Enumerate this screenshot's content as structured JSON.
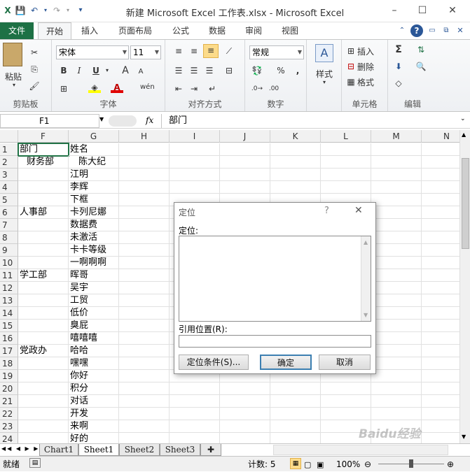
{
  "window": {
    "title": "新建 Microsoft Excel 工作表.xlsx - Microsoft Excel",
    "minimize": "–",
    "maximize": "☐",
    "close": "✕"
  },
  "ribbon_tabs": [
    "文件",
    "开始",
    "插入",
    "页面布局",
    "公式",
    "数据",
    "审阅",
    "视图"
  ],
  "clipboard": {
    "paste_label": "粘贴",
    "group_label": "剪贴板"
  },
  "font": {
    "name": "宋体",
    "size": "11",
    "bold": "B",
    "italic": "I",
    "underline": "U",
    "grow": "A",
    "shrink": "A",
    "wen": "wén",
    "group_label": "字体"
  },
  "alignment": {
    "group_label": "对齐方式"
  },
  "number": {
    "format": "常规",
    "percent": "%",
    "comma": ",",
    "group_label": "数字"
  },
  "styles": {
    "label": "样式"
  },
  "cells": {
    "insert": "插入",
    "delete": "删除",
    "format": "格式",
    "group_label": "单元格"
  },
  "editing": {
    "sigma": "Σ",
    "group_label": "编辑"
  },
  "formula_bar": {
    "name_box": "F1",
    "fx": "fx",
    "content": "部门"
  },
  "columns": [
    "F",
    "G",
    "H",
    "I",
    "J",
    "K",
    "L",
    "M",
    "N"
  ],
  "rows": [
    {
      "n": "1",
      "f": "部门",
      "g": "姓名"
    },
    {
      "n": "2",
      "f": "财务部",
      "g": "陈大纪"
    },
    {
      "n": "3",
      "f": "",
      "g": "江明"
    },
    {
      "n": "4",
      "f": "",
      "g": "李辉"
    },
    {
      "n": "5",
      "f": "",
      "g": "下框"
    },
    {
      "n": "6",
      "f": "人事部",
      "g": "卡列尼娜"
    },
    {
      "n": "7",
      "f": "",
      "g": "数据费"
    },
    {
      "n": "8",
      "f": "",
      "g": "未激活"
    },
    {
      "n": "9",
      "f": "",
      "g": "卡卡等级"
    },
    {
      "n": "10",
      "f": "",
      "g": "一啊啊啊"
    },
    {
      "n": "11",
      "f": "学工部",
      "g": "晖哥"
    },
    {
      "n": "12",
      "f": "",
      "g": "吴宇"
    },
    {
      "n": "13",
      "f": "",
      "g": "工贸"
    },
    {
      "n": "14",
      "f": "",
      "g": "低价"
    },
    {
      "n": "15",
      "f": "",
      "g": "臭屁"
    },
    {
      "n": "16",
      "f": "",
      "g": "嘻嘻嘻"
    },
    {
      "n": "17",
      "f": "党政办",
      "g": "哈哈"
    },
    {
      "n": "18",
      "f": "",
      "g": "嘿嘿"
    },
    {
      "n": "19",
      "f": "",
      "g": "你好"
    },
    {
      "n": "20",
      "f": "",
      "g": "积分"
    },
    {
      "n": "21",
      "f": "",
      "g": "对话"
    },
    {
      "n": "22",
      "f": "",
      "g": "开发"
    },
    {
      "n": "23",
      "f": "",
      "g": "来啊"
    },
    {
      "n": "24",
      "f": "",
      "g": "好的"
    }
  ],
  "sheets": [
    "Chart1",
    "Sheet1",
    "Sheet2",
    "Sheet3"
  ],
  "active_sheet": "Sheet1",
  "status": {
    "ready": "就绪",
    "count": "计数: 5",
    "zoom": "100%"
  },
  "dialog": {
    "title": "定位",
    "help": "?",
    "close": "✕",
    "goto_label": "定位:",
    "reference_label": "引用位置(R):",
    "reference_value": "",
    "special_button": "定位条件(S)...",
    "ok_button": "确定",
    "cancel_button": "取消"
  },
  "watermark": "Baidu经验",
  "colors": {
    "file_tab": "#1e7145",
    "accent": "#2b5797",
    "font_red": "#e00000",
    "highlight": "#ffff00"
  }
}
